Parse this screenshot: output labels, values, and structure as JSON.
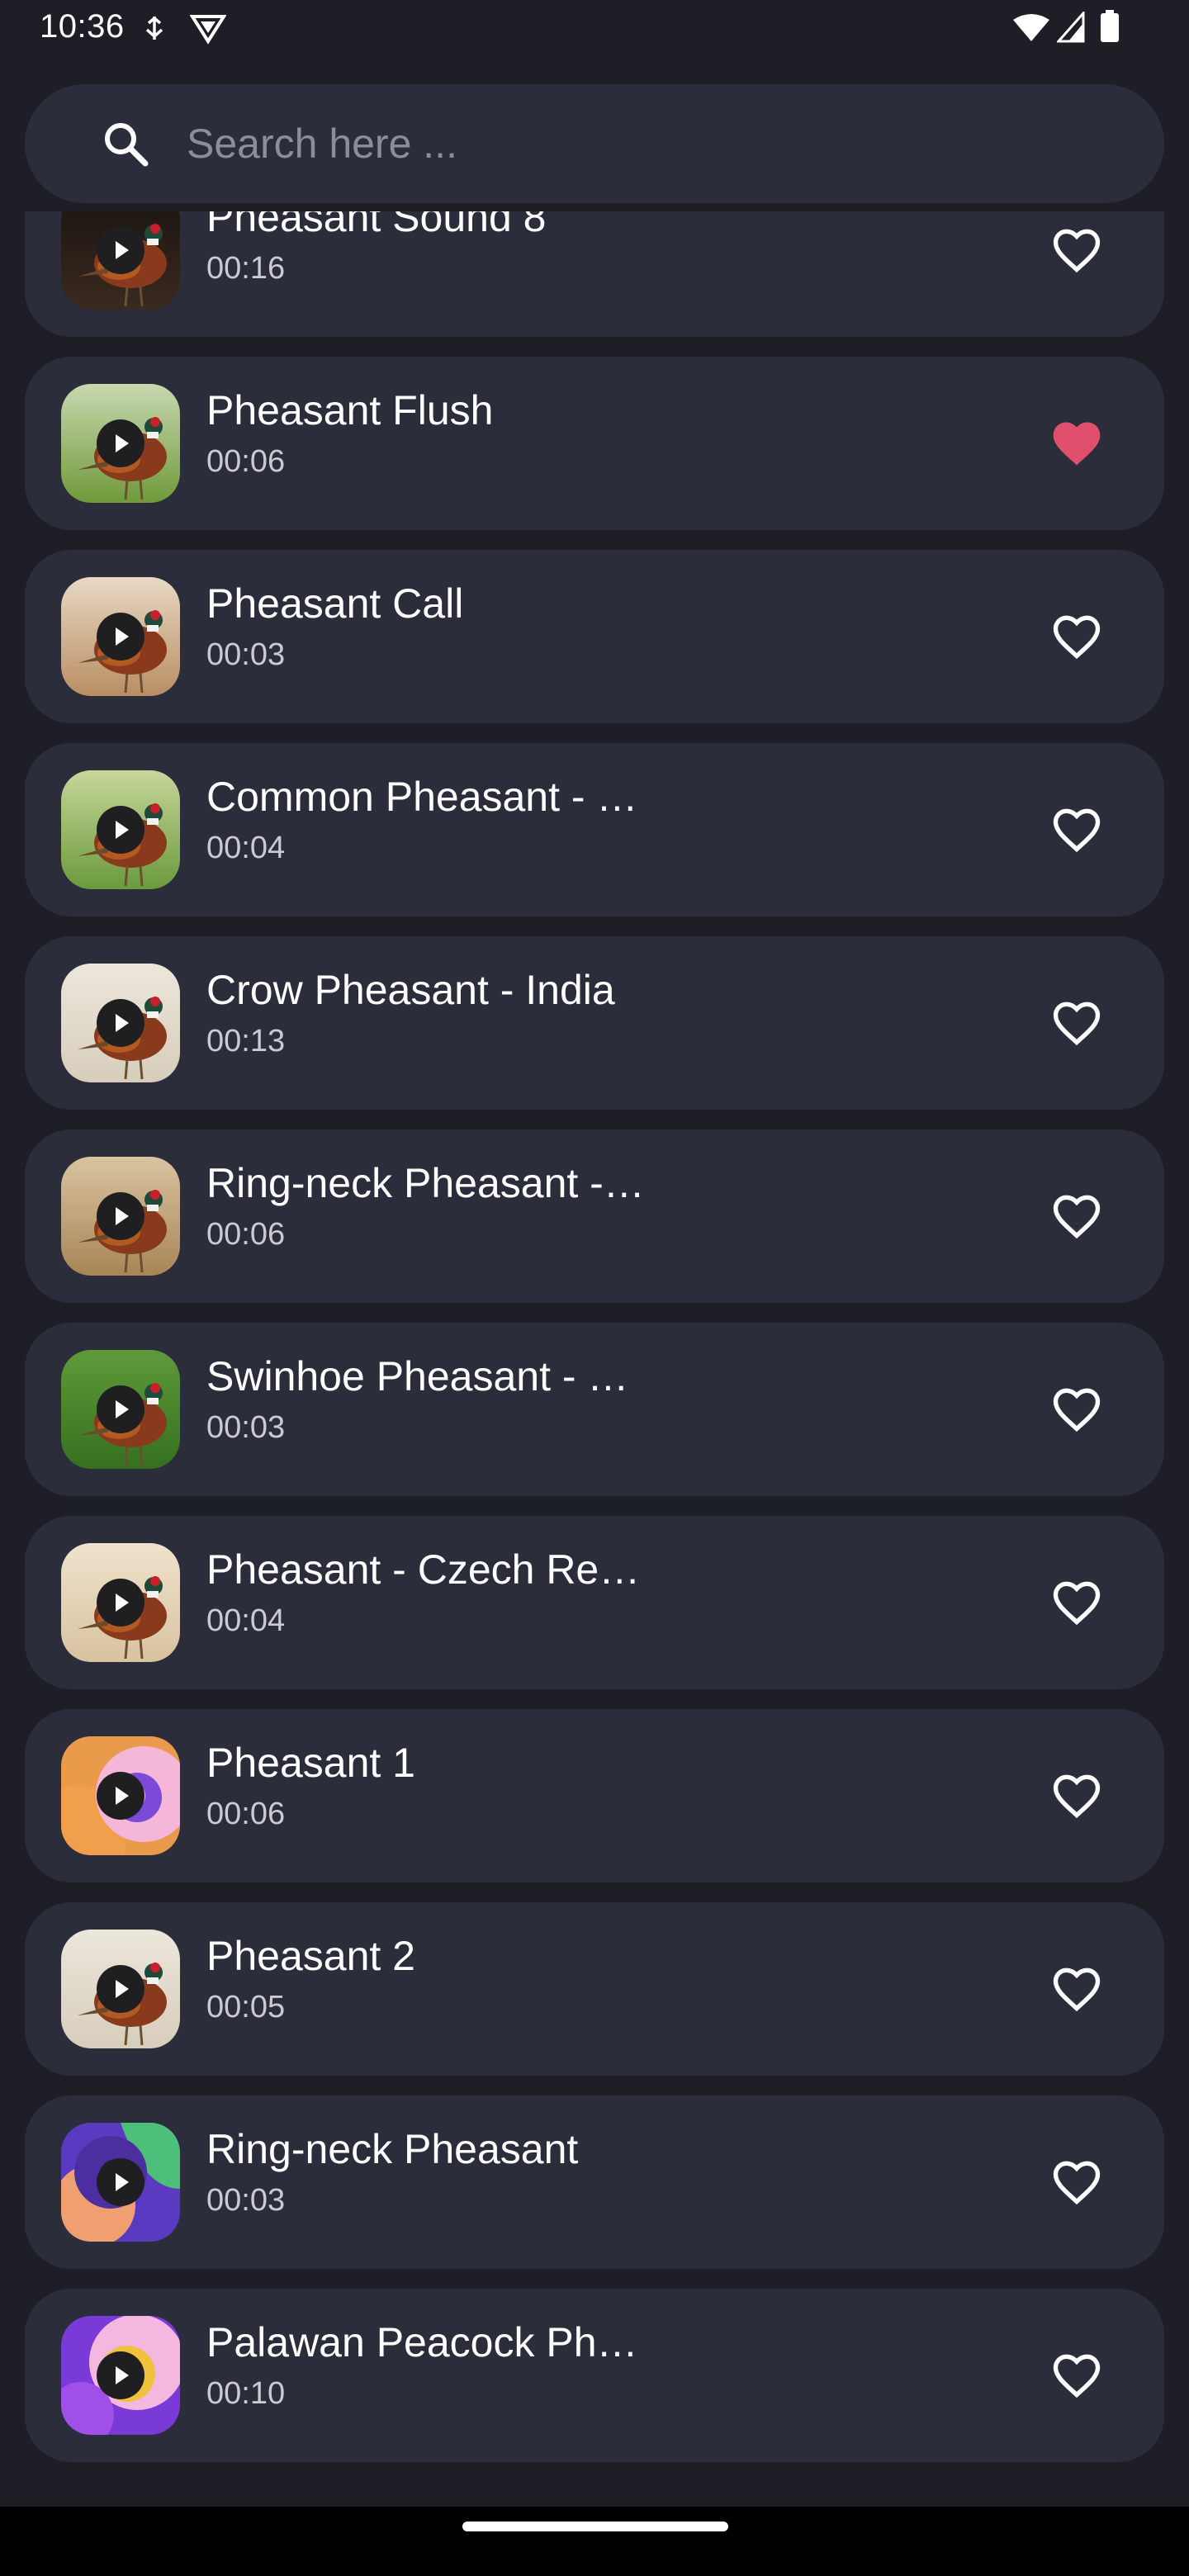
{
  "status_bar": {
    "time": "10:36",
    "icons_left": [
      "usb-debug-icon",
      "vpn-shield-icon"
    ],
    "icons_right": [
      "wifi-icon",
      "cellular-signal-icon",
      "battery-icon"
    ]
  },
  "search": {
    "placeholder": "Search here ...",
    "value": "",
    "icon": "search-icon"
  },
  "colors": {
    "background": "#1d1e26",
    "card": "#2b2d3a",
    "favorite_active": "#e0506e",
    "favorite_inactive": "#ffffff",
    "duration_text": "#c9cad2"
  },
  "sounds": [
    {
      "title": "Pheasant Sound 8",
      "duration": "00:16",
      "favorite": false,
      "thumb": "pheasant-dark"
    },
    {
      "title": "Pheasant Flush",
      "duration": "00:06",
      "favorite": true,
      "thumb": "pheasant-grass"
    },
    {
      "title": "Pheasant Call",
      "duration": "00:03",
      "favorite": false,
      "thumb": "pheasant-brown"
    },
    {
      "title": "Common Pheasant - …",
      "duration": "00:04",
      "favorite": false,
      "thumb": "pheasant-field"
    },
    {
      "title": "Crow Pheasant - India",
      "duration": "00:13",
      "favorite": false,
      "thumb": "pheasant-light"
    },
    {
      "title": "Ring-neck Pheasant -…",
      "duration": "00:06",
      "favorite": false,
      "thumb": "pheasant-straw"
    },
    {
      "title": "Swinhoe Pheasant - …",
      "duration": "00:03",
      "favorite": false,
      "thumb": "pheasant-green"
    },
    {
      "title": "Pheasant - Czech Re…",
      "duration": "00:04",
      "favorite": false,
      "thumb": "pheasant-sand"
    },
    {
      "title": "Pheasant 1",
      "duration": "00:06",
      "favorite": false,
      "thumb": "abstract-orange-purple"
    },
    {
      "title": "Pheasant 2",
      "duration": "00:05",
      "favorite": false,
      "thumb": "pheasant-light"
    },
    {
      "title": "Ring-neck Pheasant",
      "duration": "00:03",
      "favorite": false,
      "thumb": "abstract-purple-green"
    },
    {
      "title": "Palawan Peacock Ph…",
      "duration": "00:10",
      "favorite": false,
      "thumb": "abstract-purple-yellow"
    }
  ]
}
